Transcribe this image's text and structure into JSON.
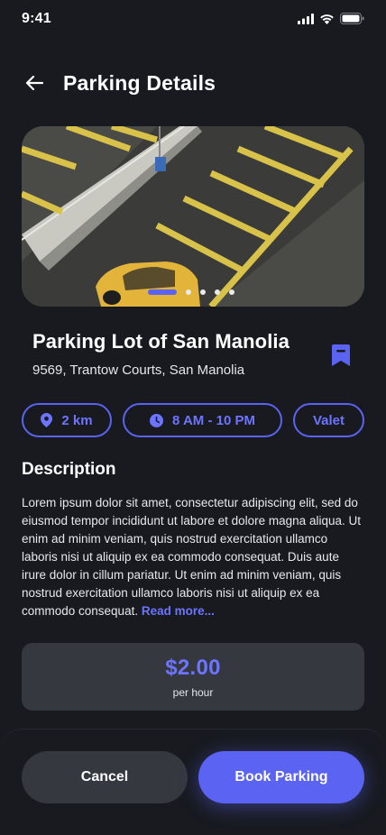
{
  "status_bar": {
    "time": "9:41"
  },
  "header": {
    "title": "Parking Details"
  },
  "carousel": {
    "slide_count": 5,
    "active_index": 0
  },
  "lot": {
    "name": "Parking Lot of San Manolia",
    "address": "9569, Trantow Courts, San Manolia",
    "bookmarked": true
  },
  "chips": {
    "distance": "2 km",
    "hours": "8 AM - 10 PM",
    "valet": "Valet"
  },
  "description": {
    "title": "Description",
    "text": "Lorem ipsum dolor sit amet, consectetur adipiscing elit, sed do eiusmod tempor incididunt ut labore et dolore magna aliqua. Ut enim ad minim veniam, quis nostrud exercitation ullamco laboris nisi ut aliquip ex ea commodo consequat. Duis aute irure dolor in cillum pariatur. Ut enim ad minim veniam, quis nostrud exercitation ullamco laboris nisi ut aliquip ex ea commodo consequat.",
    "read_more": "Read more..."
  },
  "price": {
    "value": "$2.00",
    "unit": "per hour"
  },
  "actions": {
    "cancel": "Cancel",
    "book": "Book Parking"
  },
  "colors": {
    "background": "#181a20",
    "accent": "#5b63f2",
    "card": "#35383f"
  }
}
